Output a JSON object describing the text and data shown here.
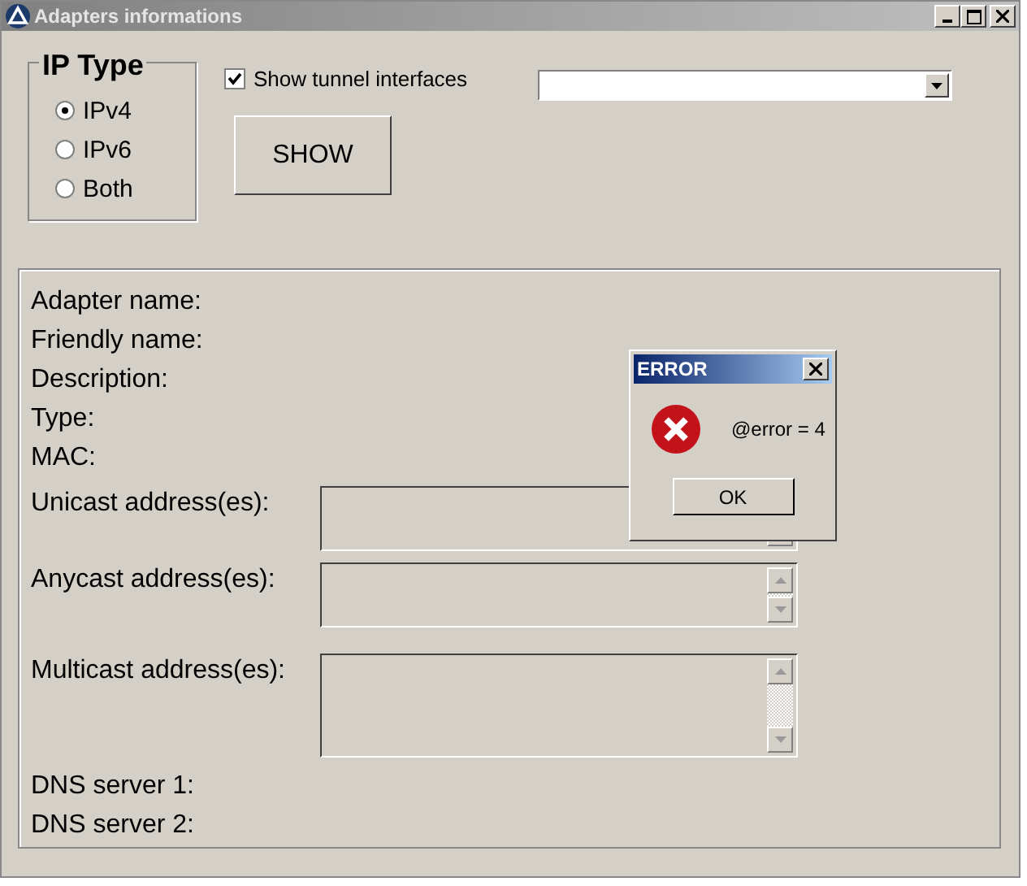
{
  "window": {
    "title": "Adapters informations"
  },
  "ip_type": {
    "title": "IP Type",
    "options": [
      {
        "label": "IPv4",
        "selected": true
      },
      {
        "label": "IPv6",
        "selected": false
      },
      {
        "label": "Both",
        "selected": false
      }
    ]
  },
  "show_tunnel": {
    "label": "Show tunnel interfaces",
    "checked": true
  },
  "show_button": "SHOW",
  "info_fields": [
    "Adapter name:",
    "Friendly name:",
    "Description:",
    "Type:",
    "MAC:"
  ],
  "address_lists": [
    "Unicast address(es):",
    "Anycast address(es):",
    "Multicast address(es):"
  ],
  "dns_fields": [
    "DNS server 1:",
    "DNS server 2:"
  ],
  "error_dialog": {
    "title": "ERROR",
    "message": "@error = 4",
    "button": "OK"
  }
}
